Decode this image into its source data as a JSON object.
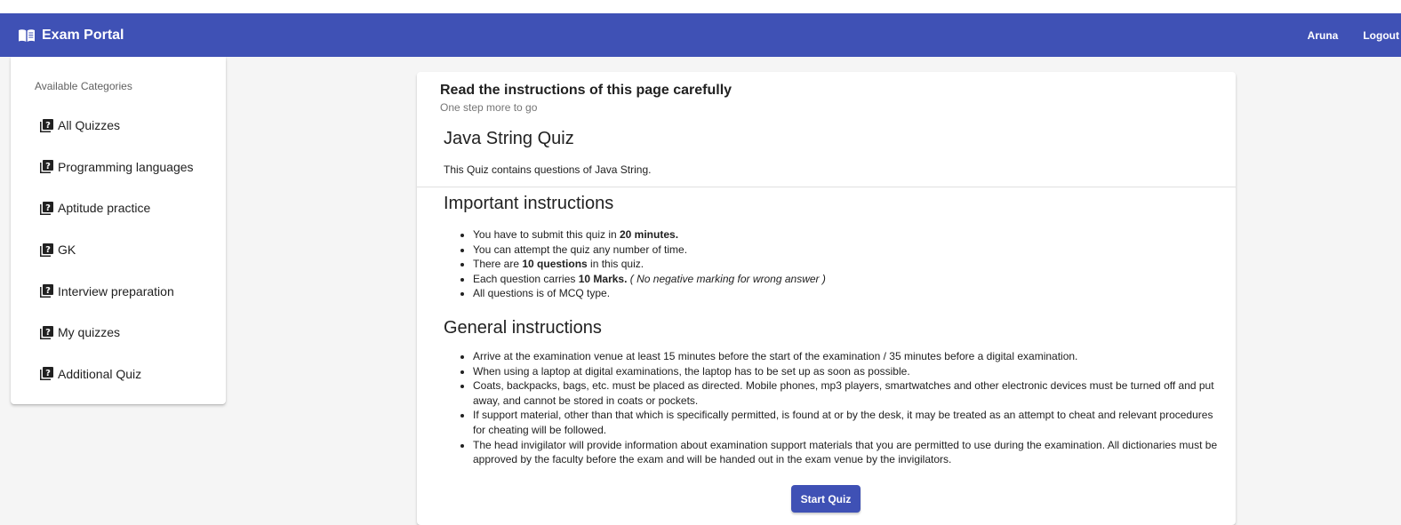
{
  "navbar": {
    "brand_title": "Exam Portal",
    "brand_icon": "menu-book-icon",
    "user_name": "Aruna",
    "logout_label": "Logout",
    "color": "#3f51b5"
  },
  "sidebar": {
    "heading": "Available Categories",
    "item_icon": "quiz-icon",
    "items": [
      {
        "label": "All Quizzes"
      },
      {
        "label": "Programming languages"
      },
      {
        "label": "Aptitude practice"
      },
      {
        "label": "GK"
      },
      {
        "label": "Interview preparation"
      },
      {
        "label": "My quizzes"
      },
      {
        "label": "Additional Quiz"
      }
    ]
  },
  "card": {
    "title": "Read the instructions of this page carefully",
    "subtitle": "One step more to go",
    "quiz_title": "Java String Quiz",
    "quiz_description": "This Quiz contains questions of Java String.",
    "important": {
      "heading": "Important instructions",
      "items": [
        {
          "pre": "You have to submit this quiz in ",
          "bold": "20 minutes.",
          "post": "",
          "italic": ""
        },
        {
          "pre": "You can attempt the quiz any number of time.",
          "bold": "",
          "post": "",
          "italic": ""
        },
        {
          "pre": "There are ",
          "bold": "10 questions",
          "post": " in this quiz.",
          "italic": ""
        },
        {
          "pre": "Each question carries ",
          "bold": "10 Marks.",
          "post": " ",
          "italic": "( No negative marking for wrong answer )"
        },
        {
          "pre": "All questions is of MCQ type.",
          "bold": "",
          "post": "",
          "italic": ""
        }
      ]
    },
    "general": {
      "heading": "General instructions",
      "items": [
        "Arrive at the examination venue at least 15 minutes before the start of the examination / 35 minutes before a digital examination.",
        "When using a laptop at digital examinations, the laptop has to be set up as soon as possible.",
        "Coats, backpacks, bags, etc. must be placed as directed. Mobile phones, mp3 players, smartwatches and other electronic devices must be turned off and put away, and cannot be stored in coats or pockets.",
        "If support material, other than that which is specifically permitted, is found at or by the desk, it may be treated as an attempt to cheat and relevant procedures for cheating will be followed.",
        "The head invigilator will provide information about examination support materials that you are permitted to use during the examination. All dictionaries must be approved by the faculty before the exam and will be handed out in the exam venue by the invigilators."
      ]
    },
    "start_label": "Start Quiz"
  }
}
